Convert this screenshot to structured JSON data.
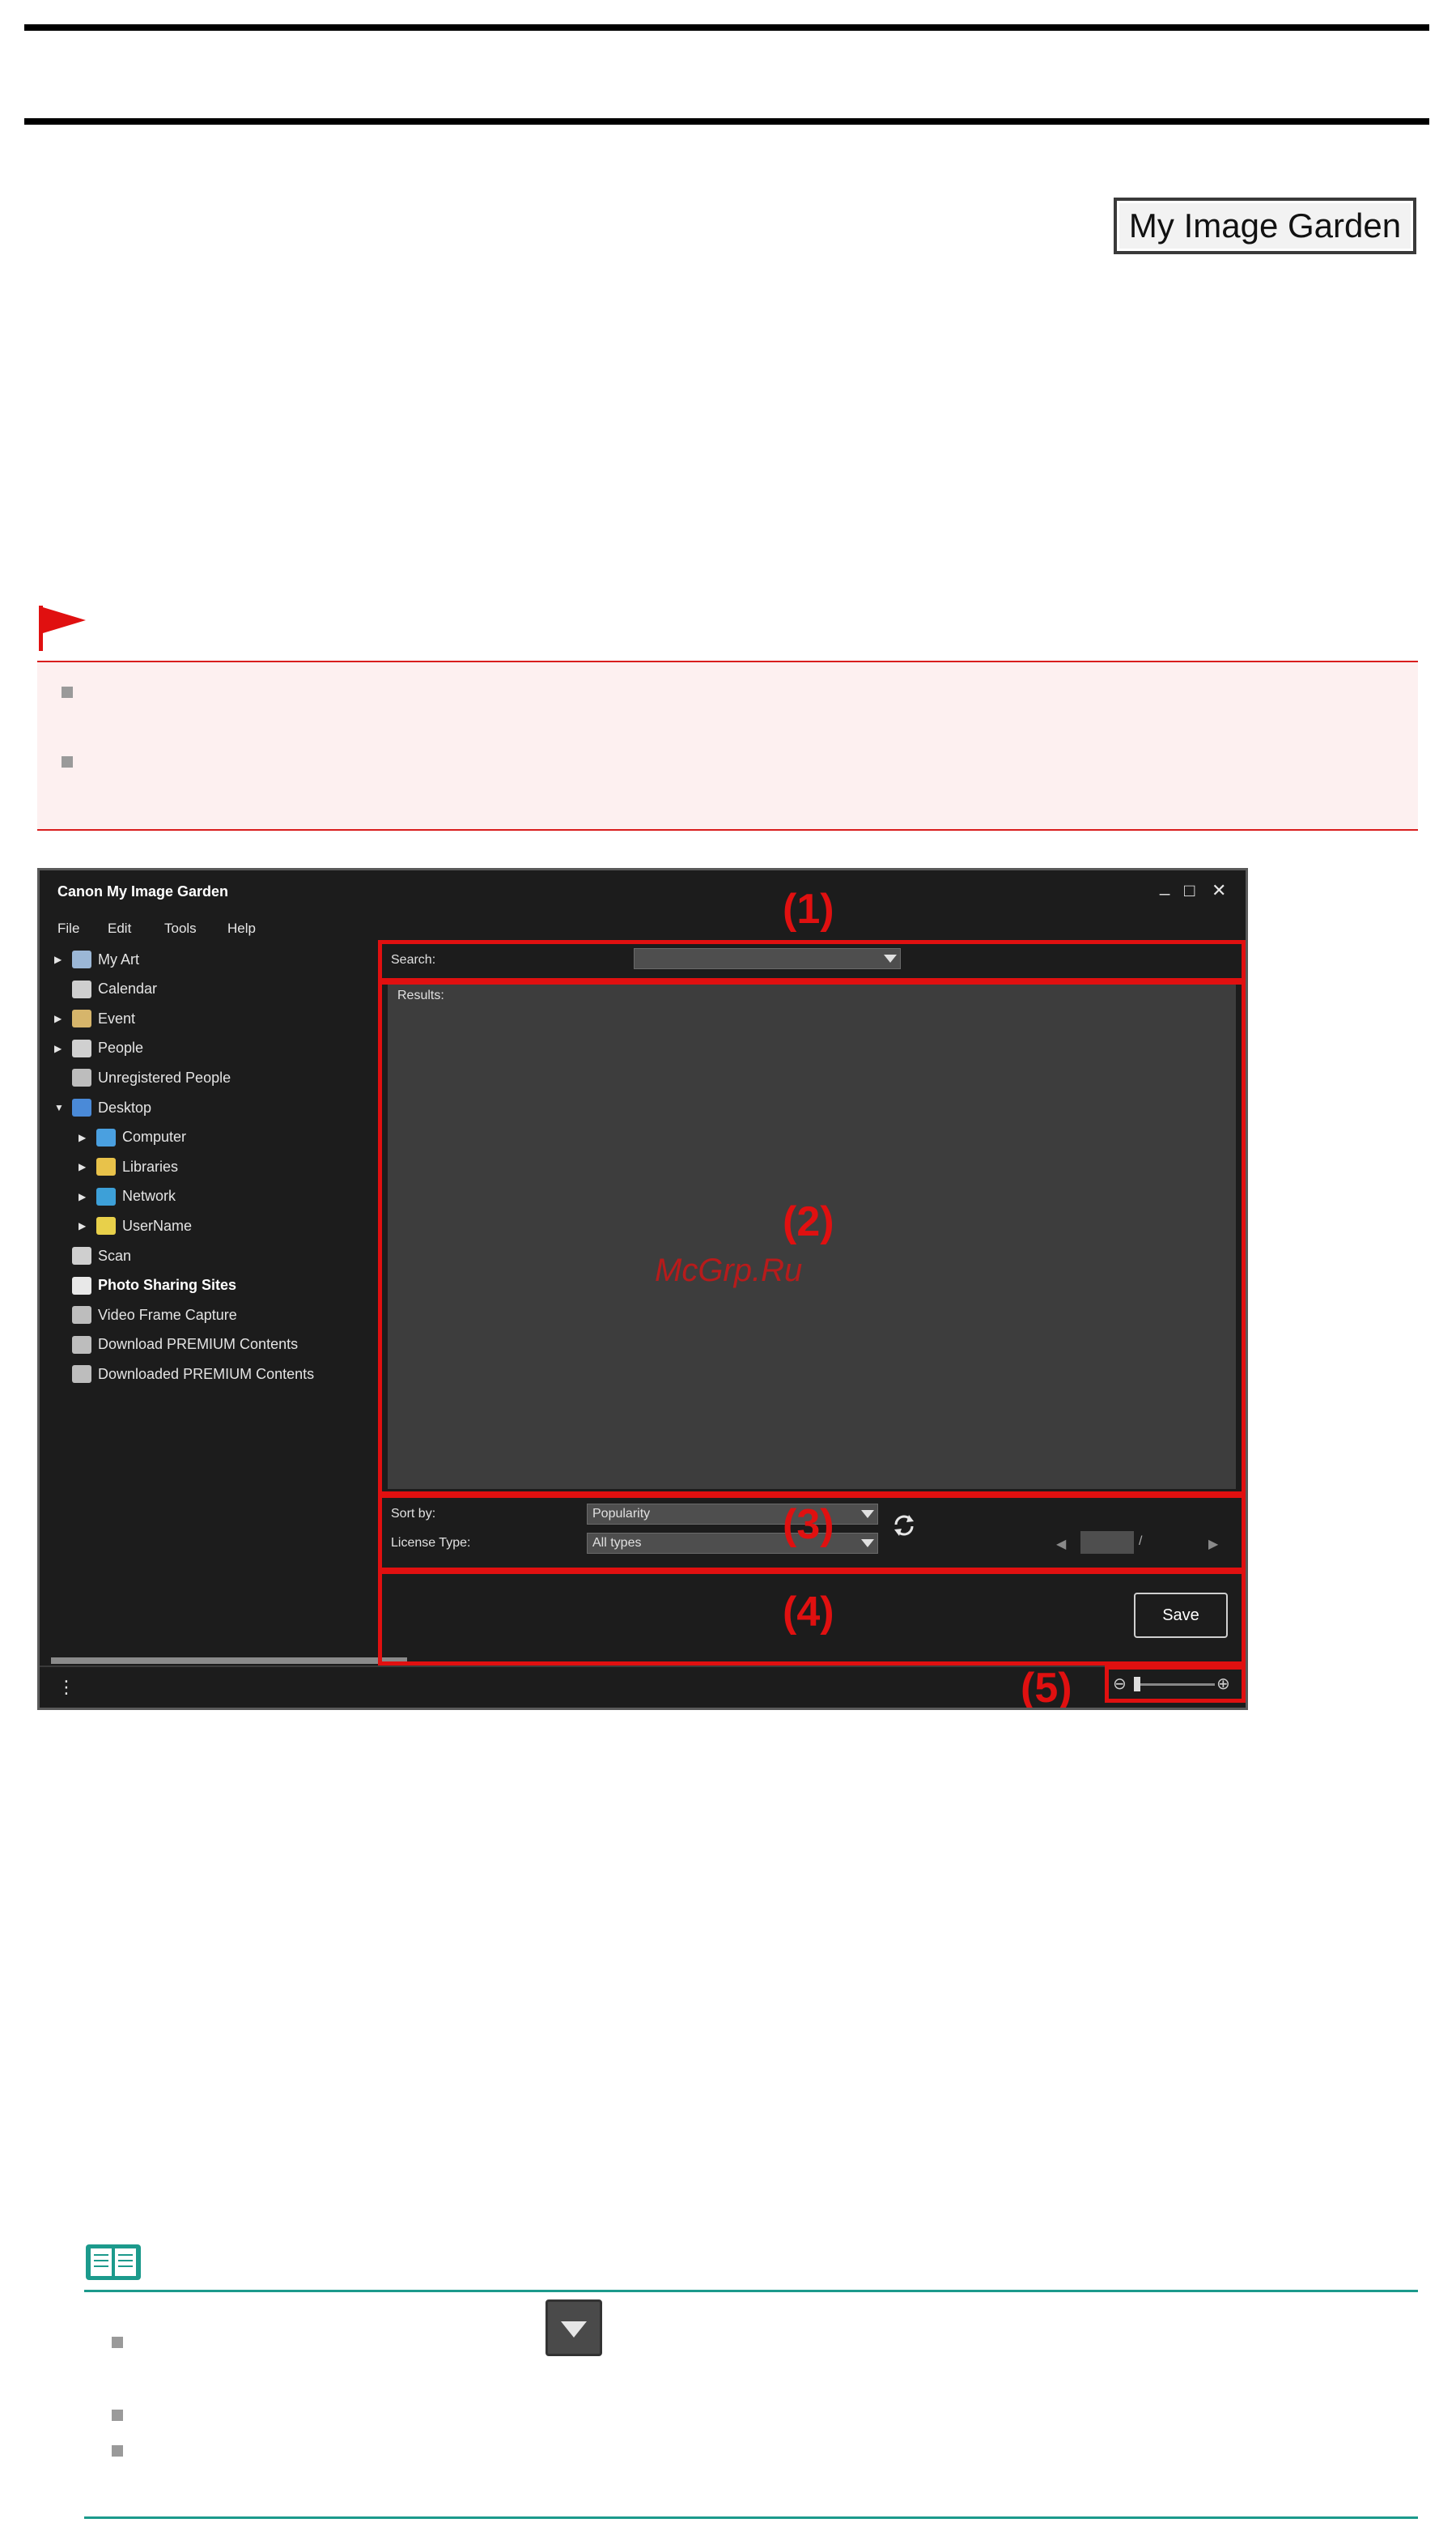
{
  "header": {
    "logo_text": "My Image Garden"
  },
  "window": {
    "title": "Canon My Image Garden",
    "controls": {
      "minimize": "_",
      "maximize": "□",
      "close": "✕"
    },
    "menu": [
      "File",
      "Edit",
      "Tools",
      "Help"
    ],
    "tree": [
      {
        "label": "My Art",
        "expander": "▶",
        "icon": "my-art-icon",
        "indent": 0,
        "bold": false
      },
      {
        "label": "Calendar",
        "expander": "",
        "icon": "calendar-icon",
        "indent": 0,
        "bold": false
      },
      {
        "label": "Event",
        "expander": "▶",
        "icon": "event-icon",
        "indent": 0,
        "bold": false
      },
      {
        "label": "People",
        "expander": "▶",
        "icon": "people-icon",
        "indent": 0,
        "bold": false
      },
      {
        "label": "Unregistered People",
        "expander": "",
        "icon": "unregistered-people-icon",
        "indent": 0,
        "bold": false
      },
      {
        "label": "Desktop",
        "expander": "▼",
        "icon": "desktop-icon",
        "indent": 0,
        "bold": false
      },
      {
        "label": "Computer",
        "expander": "▶",
        "icon": "computer-icon",
        "indent": 1,
        "bold": false
      },
      {
        "label": "Libraries",
        "expander": "▶",
        "icon": "libraries-icon",
        "indent": 1,
        "bold": false
      },
      {
        "label": "Network",
        "expander": "▶",
        "icon": "network-icon",
        "indent": 1,
        "bold": false
      },
      {
        "label": "UserName",
        "expander": "▶",
        "icon": "user-folder-icon",
        "indent": 1,
        "bold": false
      },
      {
        "label": "Scan",
        "expander": "",
        "icon": "scan-icon",
        "indent": 0,
        "bold": false
      },
      {
        "label": "Photo Sharing Sites",
        "expander": "",
        "icon": "photo-sharing-icon",
        "indent": 0,
        "bold": true
      },
      {
        "label": "Video Frame Capture",
        "expander": "",
        "icon": "video-frame-icon",
        "indent": 0,
        "bold": false
      },
      {
        "label": "Download PREMIUM Contents",
        "expander": "",
        "icon": "download-premium-icon",
        "indent": 0,
        "bold": false
      },
      {
        "label": "Downloaded PREMIUM Contents",
        "expander": "",
        "icon": "downloaded-premium-icon",
        "indent": 0,
        "bold": false
      }
    ],
    "search": {
      "label": "Search:",
      "value": ""
    },
    "results_label": "Results:",
    "sort_by": {
      "label": "Sort by:",
      "value": "Popularity"
    },
    "license_type": {
      "label": "License Type:",
      "value": "All types"
    },
    "page_separator": "/",
    "save_label": "Save",
    "status_icon": "⋮"
  },
  "regions": [
    "(1)",
    "(2)",
    "(3)",
    "(4)",
    "(5)"
  ],
  "watermark": "McGrp.Ru",
  "colors": {
    "highlight": "#e01010",
    "caution": "#d91e1e",
    "note": "#1c9a8c"
  }
}
